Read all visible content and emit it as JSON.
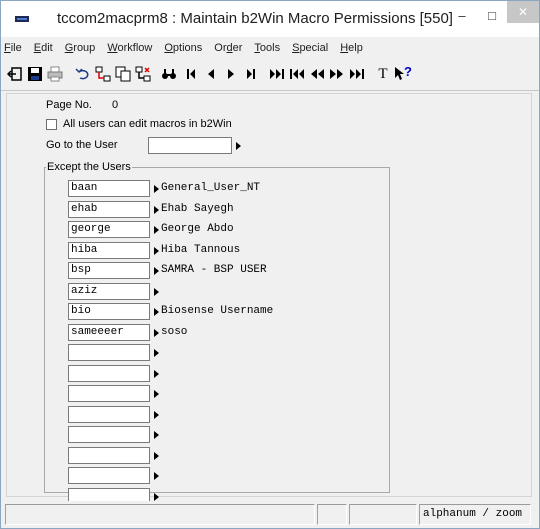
{
  "window": {
    "title": "tccom2macprm8 : Maintain b2Win Macro Permissions [550]",
    "minimize_symbol": "–",
    "maximize_symbol": "□",
    "close_symbol": "✕"
  },
  "menu": [
    {
      "ul": "F",
      "rest": "ile"
    },
    {
      "ul": "E",
      "rest": "dit"
    },
    {
      "ul": "G",
      "rest": "roup"
    },
    {
      "ul": "W",
      "rest": "orkflow"
    },
    {
      "ul": "O",
      "rest": "ptions"
    },
    {
      "pre": "Or",
      "ul": "d",
      "rest": "er"
    },
    {
      "ul": "T",
      "rest": "ools"
    },
    {
      "ul": "S",
      "rest": "pecial"
    },
    {
      "ul": "H",
      "rest": "elp"
    }
  ],
  "toolbar": {
    "icons": [
      "exit-icon",
      "save-icon",
      "print-icon",
      "undo-icon",
      "insert-record-icon",
      "duplicate-icon",
      "delete-record-icon",
      "find-icon",
      "first-record-icon",
      "previous-record-icon",
      "next-record-icon",
      "last-record-icon",
      "first-set-icon",
      "previous-set-icon",
      "previous-page-icon",
      "next-page-icon",
      "last-page-icon",
      "text-icon",
      "help-icon"
    ],
    "text_glyph": "T",
    "help_glyph": "?"
  },
  "form": {
    "page_no_label": "Page No.",
    "page_no_value": "0",
    "all_users_label": "All users can edit macros in b2Win",
    "all_users_checked": false,
    "goto_user_label": "Go to the User",
    "goto_user_value": "",
    "except_users_label": "Except the Users",
    "users": [
      {
        "code": "baan",
        "name": "General_User_NT"
      },
      {
        "code": "ehab",
        "name": "Ehab Sayegh"
      },
      {
        "code": "george",
        "name": "George Abdo"
      },
      {
        "code": "hiba",
        "name": "Hiba Tannous"
      },
      {
        "code": "bsp",
        "name": "SAMRA - BSP USER"
      },
      {
        "code": "aziz",
        "name": ""
      },
      {
        "code": "bio",
        "name": "Biosense Username"
      },
      {
        "code": "sameeeer",
        "name": "soso"
      },
      {
        "code": "",
        "name": ""
      },
      {
        "code": "",
        "name": ""
      },
      {
        "code": "",
        "name": ""
      },
      {
        "code": "",
        "name": ""
      },
      {
        "code": "",
        "name": ""
      },
      {
        "code": "",
        "name": ""
      },
      {
        "code": "",
        "name": ""
      },
      {
        "code": "",
        "name": ""
      }
    ]
  },
  "statusbar": {
    "cell1": "",
    "cell2": "",
    "cell3": "",
    "field_type": "alphanum / zoom"
  }
}
